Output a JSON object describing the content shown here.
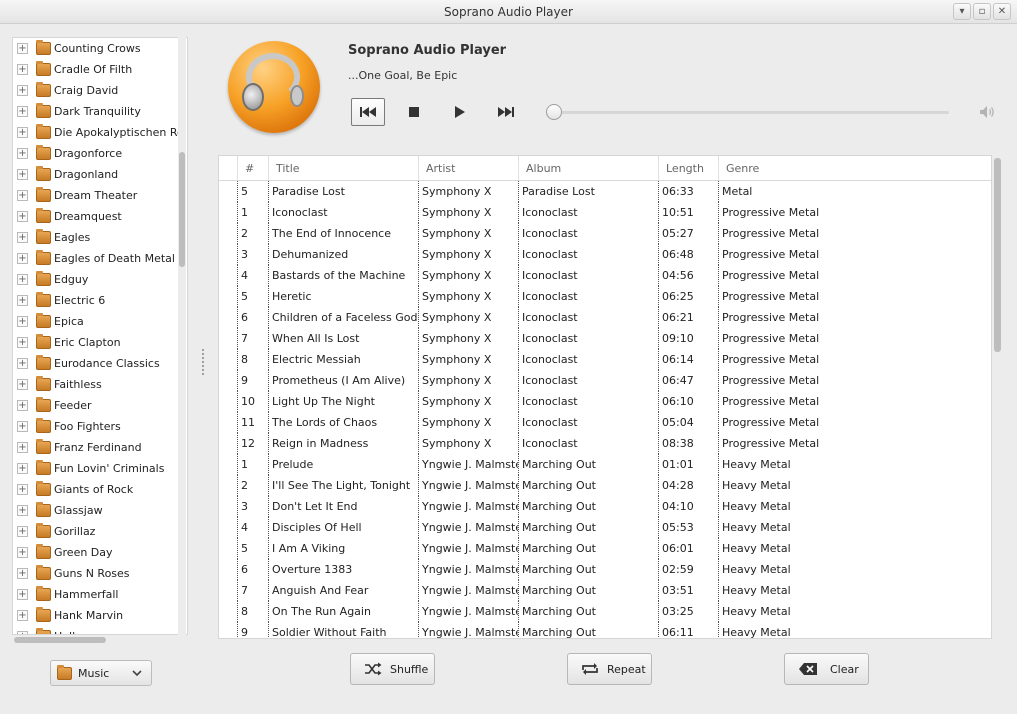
{
  "window": {
    "title": "Soprano Audio Player",
    "minimize_label": "▾",
    "restore_label": "▫",
    "close_label": "✕"
  },
  "sidebar": {
    "artists": [
      "Counting Crows",
      "Cradle Of Filth",
      "Craig David",
      "Dark Tranquility",
      "Die Apokalyptischen Reiter",
      "Dragonforce",
      "Dragonland",
      "Dream Theater",
      "Dreamquest",
      "Eagles",
      "Eagles of Death Metal",
      "Edguy",
      "Electric 6",
      "Epica",
      "Eric Clapton",
      "Eurodance Classics",
      "Faithless",
      "Feeder",
      "Foo Fighters",
      "Franz Ferdinand",
      "Fun Lovin' Criminals",
      "Giants of Rock",
      "Glassjaw",
      "Gorillaz",
      "Green Day",
      "Guns N Roses",
      "Hammerfall",
      "Hank Marvin",
      "Halloween"
    ],
    "expander_symbol": "+",
    "source_select": "Music"
  },
  "header": {
    "title": "Soprano Audio Player",
    "tagline": "...One Goal, Be Epic"
  },
  "playlist": {
    "columns": [
      "#",
      "Title",
      "Artist",
      "Album",
      "Length",
      "Genre"
    ],
    "rows": [
      [
        "5",
        "Paradise Lost",
        "Symphony X",
        "Paradise Lost",
        "06:33",
        "Metal"
      ],
      [
        "1",
        "Iconoclast",
        "Symphony X",
        "Iconoclast",
        "10:51",
        "Progressive Metal"
      ],
      [
        "2",
        "The End of Innocence",
        "Symphony X",
        "Iconoclast",
        "05:27",
        "Progressive Metal"
      ],
      [
        "3",
        "Dehumanized",
        "Symphony X",
        "Iconoclast",
        "06:48",
        "Progressive Metal"
      ],
      [
        "4",
        "Bastards of the Machine",
        "Symphony X",
        "Iconoclast",
        "04:56",
        "Progressive Metal"
      ],
      [
        "5",
        "Heretic",
        "Symphony X",
        "Iconoclast",
        "06:25",
        "Progressive Metal"
      ],
      [
        "6",
        "Children of a Faceless God",
        "Symphony X",
        "Iconoclast",
        "06:21",
        "Progressive Metal"
      ],
      [
        "7",
        "When All Is Lost",
        "Symphony X",
        "Iconoclast",
        "09:10",
        "Progressive Metal"
      ],
      [
        "8",
        "Electric Messiah",
        "Symphony X",
        "Iconoclast",
        "06:14",
        "Progressive Metal"
      ],
      [
        "9",
        "Prometheus (I Am Alive)",
        "Symphony X",
        "Iconoclast",
        "06:47",
        "Progressive Metal"
      ],
      [
        "10",
        "Light Up The Night",
        "Symphony X",
        "Iconoclast",
        "06:10",
        "Progressive Metal"
      ],
      [
        "11",
        "The Lords of Chaos",
        "Symphony X",
        "Iconoclast",
        "05:04",
        "Progressive Metal"
      ],
      [
        "12",
        "Reign in Madness",
        "Symphony X",
        "Iconoclast",
        "08:38",
        "Progressive Metal"
      ],
      [
        "1",
        "Prelude",
        "Yngwie J. Malmsteen",
        "Marching Out",
        "01:01",
        "Heavy Metal"
      ],
      [
        "2",
        "I'll See The Light, Tonight",
        "Yngwie J. Malmsteen",
        "Marching Out",
        "04:28",
        "Heavy Metal"
      ],
      [
        "3",
        "Don't Let It End",
        "Yngwie J. Malmsteen",
        "Marching Out",
        "04:10",
        "Heavy Metal"
      ],
      [
        "4",
        "Disciples Of Hell",
        "Yngwie J. Malmsteen",
        "Marching Out",
        "05:53",
        "Heavy Metal"
      ],
      [
        "5",
        "I Am A Viking",
        "Yngwie J. Malmsteen",
        "Marching Out",
        "06:01",
        "Heavy Metal"
      ],
      [
        "6",
        "Overture 1383",
        "Yngwie J. Malmsteen",
        "Marching Out",
        "02:59",
        "Heavy Metal"
      ],
      [
        "7",
        "Anguish And Fear",
        "Yngwie J. Malmsteen",
        "Marching Out",
        "03:51",
        "Heavy Metal"
      ],
      [
        "8",
        "On The Run Again",
        "Yngwie J. Malmsteen",
        "Marching Out",
        "03:25",
        "Heavy Metal"
      ],
      [
        "9",
        "Soldier Without Faith",
        "Yngwie J. Malmsteen",
        "Marching Out",
        "06:11",
        "Heavy Metal"
      ]
    ]
  },
  "playback": {
    "seek_position": 0
  },
  "buttons": {
    "shuffle": "Shuffle",
    "repeat": "Repeat",
    "clear": "Clear"
  },
  "icons": {
    "previous": "skip-previous-icon",
    "stop": "stop-icon",
    "play": "play-icon",
    "next": "skip-next-icon",
    "volume": "volume-icon",
    "shuffle": "shuffle-icon",
    "repeat": "repeat-icon",
    "clear": "backspace-icon",
    "folder": "folder-icon",
    "logo": "headphones-logo"
  },
  "colors": {
    "folder": "#d48d3a",
    "logo_orange": "#f7a227"
  }
}
